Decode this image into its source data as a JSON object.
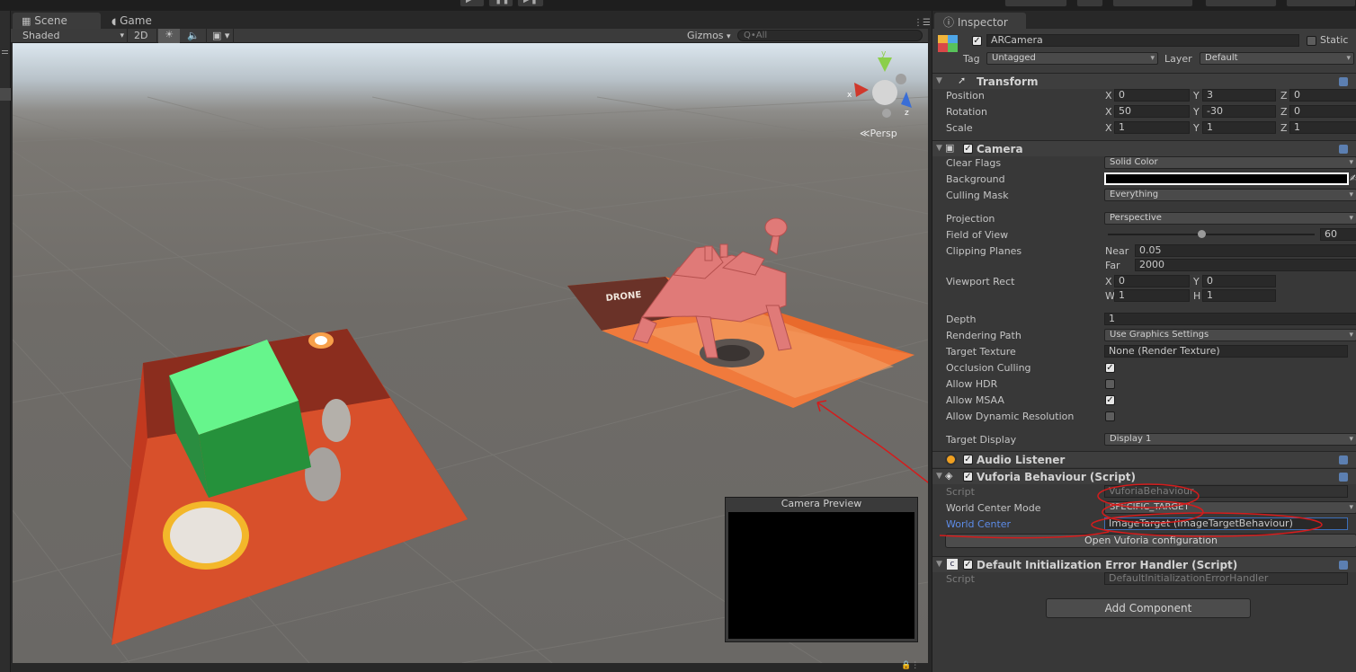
{
  "scene_window": {
    "tabs": [
      {
        "label": "Scene"
      },
      {
        "label": "Game"
      }
    ],
    "toolbar": {
      "shading": "Shaded",
      "mode_2d": "2D",
      "gizmos": "Gizmos",
      "search_placeholder": "Q•All"
    },
    "gizmo": {
      "persp_label": "Persp",
      "axis_x": "x",
      "axis_y": "y",
      "axis_z": "z"
    },
    "card_text": "DRONE",
    "camera_preview": {
      "title": "Camera Preview"
    }
  },
  "inspector": {
    "tab": "Inspector",
    "object": {
      "name": "ARCamera",
      "static_label": "Static",
      "tag_label": "Tag",
      "tag_value": "Untagged",
      "layer_label": "Layer",
      "layer_value": "Default"
    },
    "transform": {
      "title": "Transform",
      "rows": [
        {
          "label": "Position",
          "x": "0",
          "y": "3",
          "z": "0"
        },
        {
          "label": "Rotation",
          "x": "50",
          "y": "-30",
          "z": "0"
        },
        {
          "label": "Scale",
          "x": "1",
          "y": "1",
          "z": "1"
        }
      ],
      "axis_labels": {
        "x": "X",
        "y": "Y",
        "z": "Z"
      }
    },
    "camera": {
      "title": "Camera",
      "clear_flags_label": "Clear Flags",
      "clear_flags": "Solid Color",
      "background_label": "Background",
      "background_color": "#000000",
      "culling_mask_label": "Culling Mask",
      "culling_mask": "Everything",
      "projection_label": "Projection",
      "projection": "Perspective",
      "fov_label": "Field of View",
      "fov": "60",
      "fov_fraction": 0.45,
      "clipping_label": "Clipping Planes",
      "near_label": "Near",
      "near": "0.05",
      "far_label": "Far",
      "far": "2000",
      "viewport_label": "Viewport Rect",
      "vp_x_label": "X",
      "vp_x": "0",
      "vp_y_label": "Y",
      "vp_y": "0",
      "vp_w_label": "W",
      "vp_w": "1",
      "vp_h_label": "H",
      "vp_h": "1",
      "depth_label": "Depth",
      "depth": "1",
      "rendering_path_label": "Rendering Path",
      "rendering_path": "Use Graphics Settings",
      "target_texture_label": "Target Texture",
      "target_texture": "None (Render Texture)",
      "occlusion_label": "Occlusion Culling",
      "occlusion": true,
      "hdr_label": "Allow HDR",
      "hdr": false,
      "msaa_label": "Allow MSAA",
      "msaa": true,
      "dynres_label": "Allow Dynamic Resolution",
      "dynres": false,
      "display_label": "Target Display",
      "display": "Display 1"
    },
    "audio_listener": {
      "title": "Audio Listener"
    },
    "vuforia": {
      "title": "Vuforia Behaviour (Script)",
      "script_label": "Script",
      "script": "VuforiaBehaviour",
      "world_center_mode_label": "World Center Mode",
      "world_center_mode": "SPECIFIC_TARGET",
      "world_center_label": "World Center",
      "world_center": "ImageTarget (ImageTargetBehaviour)",
      "config_button": "Open Vuforia configuration"
    },
    "error_handler": {
      "title": "Default Initialization Error Handler (Script)",
      "script_label": "Script",
      "script": "DefaultInitializationErrorHandler"
    },
    "add_component": "Add Component"
  },
  "colors": {
    "annotation": "#d41c1c",
    "link_label": "#5d8ce8",
    "cube_top": "#66f58c",
    "cube_front": "#25913b"
  }
}
